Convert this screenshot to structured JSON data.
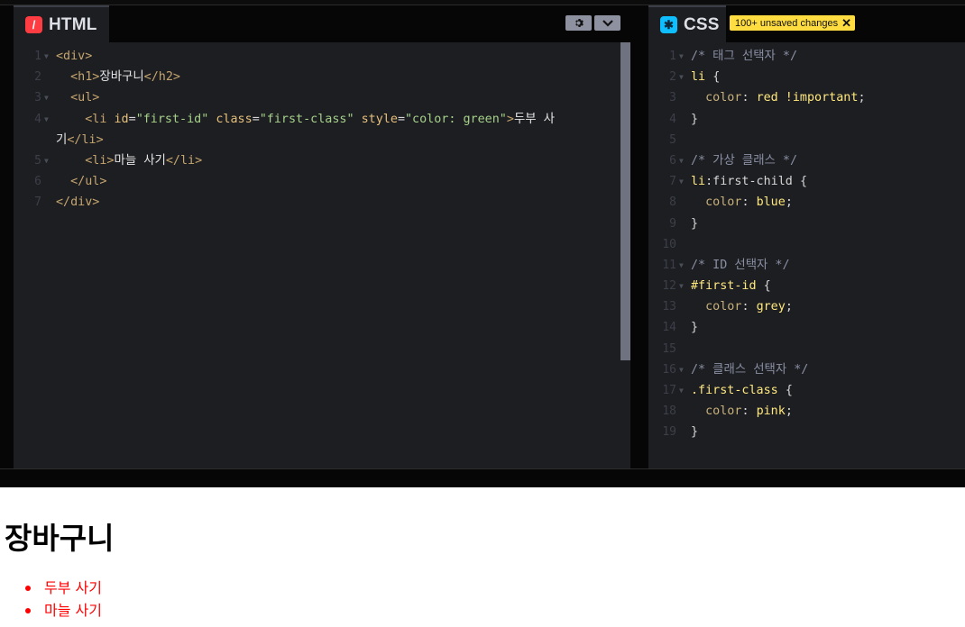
{
  "html_panel": {
    "title": "HTML",
    "icon": "html-icon",
    "buttons": {
      "settings": "gear-icon",
      "collapse": "chevron-down-icon"
    },
    "lines": [
      {
        "num": "1",
        "fold": true
      },
      {
        "num": "2",
        "fold": false
      },
      {
        "num": "3",
        "fold": true
      },
      {
        "num": "4",
        "fold": true
      },
      {
        "num": "5",
        "fold": true
      },
      {
        "num": "6",
        "fold": false
      },
      {
        "num": "7",
        "fold": false
      }
    ],
    "code": {
      "l1": "<div>",
      "l2_open": "<h1>",
      "l2_text": "장바구니",
      "l2_close": "</h2>",
      "l3": "<ul>",
      "l4_open": "<li ",
      "l4_attr1": "id",
      "l4_val1": "\"first-id\"",
      "l4_attr2": "class",
      "l4_val2": "\"first-class\"",
      "l4_attr3": "style",
      "l4_val3": "\"color: green\"",
      "l4_close": ">",
      "l4_text": "두부 사",
      "l4_wrap_text": "기",
      "l4_end": "</li>",
      "l5_open": "<li>",
      "l5_text": "마늘 사기",
      "l5_close": "</li>",
      "l6": "</ul>",
      "l7": "</div>"
    }
  },
  "css_panel": {
    "title": "CSS",
    "icon": "css-icon",
    "badge": "100+ unsaved changes",
    "code": {
      "c1": "/* 태그 선택자 */",
      "c2_sel": "li",
      "c3_prop": "color",
      "c3_val": "red !important",
      "c6": "/* 가상 클래스 */",
      "c7_sel": "li",
      "c7_pseudo": ":first-child",
      "c8_prop": "color",
      "c8_val": "blue",
      "c11": "/* ID 선택자 */",
      "c12_sel": "#first-id",
      "c13_prop": "color",
      "c13_val": "grey",
      "c16": "/* 클래스 선택자 */",
      "c17_sel": ".first-class",
      "c18_prop": "color",
      "c18_val": "pink"
    }
  },
  "result": {
    "heading": "장바구니",
    "items": [
      "두부 사기",
      "마늘 사기"
    ],
    "item_color": "#ff0000"
  },
  "colors": {
    "editor_bg": "#1d1e22",
    "chrome_bg": "#060606",
    "badge": "#ffdd40",
    "html_icon": "#ff3c41",
    "css_icon": "#0ebeff"
  }
}
